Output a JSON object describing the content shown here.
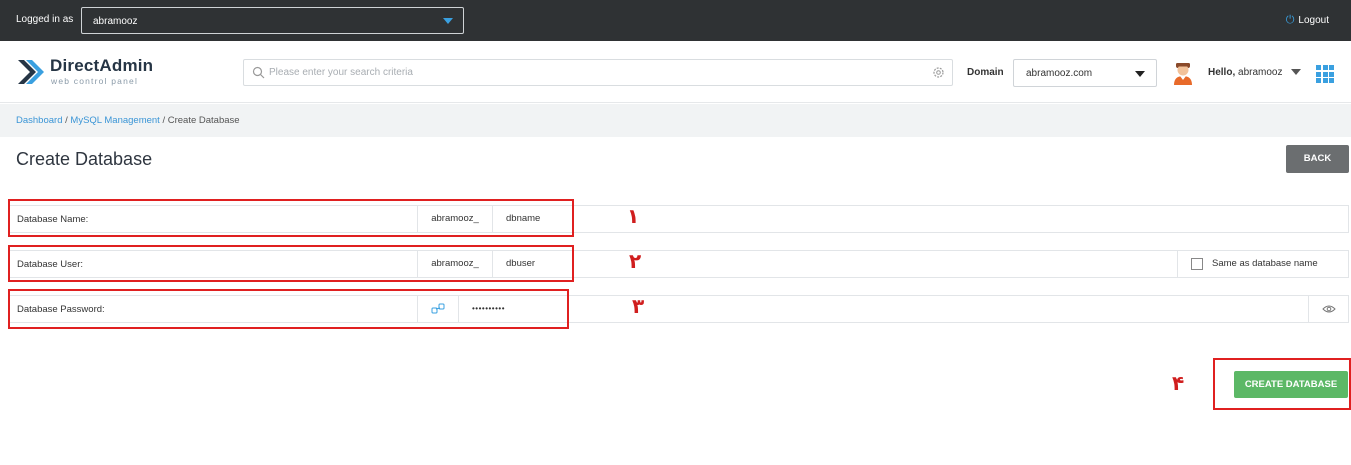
{
  "topbar": {
    "logged_in_label": "Logged in as",
    "user_value": "abramooz",
    "logout_label": "Logout"
  },
  "header": {
    "logo_title": "DirectAdmin",
    "logo_subtitle": "web control panel",
    "search_placeholder": "Please enter your search criteria",
    "domain_label": "Domain",
    "domain_value": "abramooz.com",
    "hello_prefix": "Hello,",
    "hello_user": "abramooz"
  },
  "breadcrumb": {
    "items": [
      "Dashboard",
      "MySQL Management",
      "Create Database"
    ],
    "separator": " / "
  },
  "page": {
    "title": "Create Database",
    "back_label": "BACK"
  },
  "form": {
    "db_name": {
      "label": "Database Name:",
      "prefix": "abramooz_",
      "value": "dbname"
    },
    "db_user": {
      "label": "Database User:",
      "prefix": "abramooz_",
      "value": "dbuser",
      "checkbox_label": "Same as database name",
      "checkbox_checked": false
    },
    "db_password": {
      "label": "Database Password:",
      "value": "••••••••••"
    },
    "submit_label": "CREATE DATABASE"
  },
  "annotations": {
    "marker_1": "۱",
    "marker_2": "۲",
    "marker_3": "۳",
    "marker_4": "۴"
  },
  "colors": {
    "topbar_bg": "#2f3234",
    "accent_blue": "#3aa0e0",
    "link_blue": "#3a95d6",
    "back_button": "#6b6e70",
    "create_button": "#5cb866",
    "annotation_red": "#e02020"
  },
  "icons": {
    "search": "search-icon",
    "settings": "gear-icon",
    "generate_password": "key-generate-icon",
    "show_password": "eye-icon",
    "logout": "power-icon",
    "apps": "grid-icon"
  }
}
